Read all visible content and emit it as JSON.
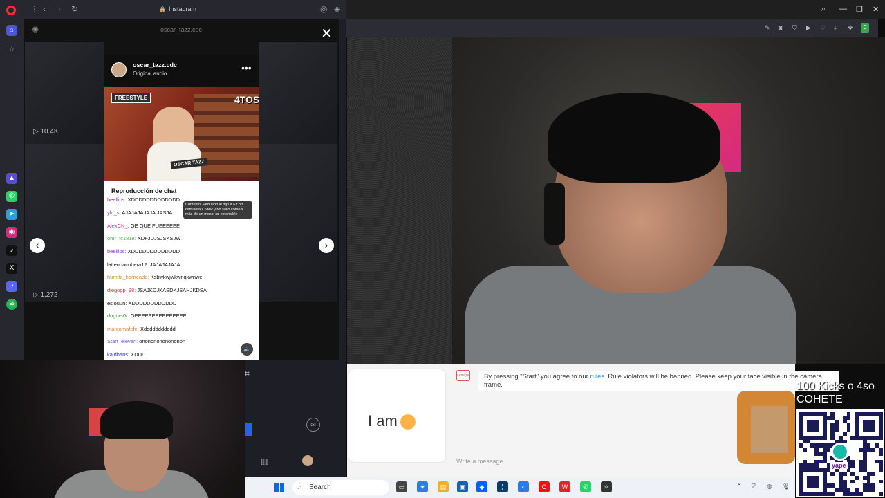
{
  "browser": {
    "tab_title": "Instagram",
    "ig_username_top": "oscar_tazz.cdc",
    "views_1": "10.4K",
    "views_2": "1,272"
  },
  "reel": {
    "username": "oscar_tazz.cdc",
    "audio": "Original audio",
    "video_badge_left": "FREESTYLE",
    "video_badge_right": "4TOS",
    "video_badge_name": "OSCAR TAZZ",
    "chat_title": "Reproducción de chat",
    "tooltip": "Contexto: Peduano le dijo a Ez no camiseta x SMP y no salio como x más de un mes x su extensible",
    "messages": [
      {
        "user": "beellips:",
        "text": "XDDDDDDDDDDDDD",
        "color": "#8a3bd6"
      },
      {
        "user": "ylu_s:",
        "text": "AJAJAJAJAJA JASJA",
        "color": "#8a3bd6"
      },
      {
        "user": "AlexCN_:",
        "text": "OE QUE FUEEEEEE",
        "color": "#d63b8f"
      },
      {
        "user": "omr_fc1818:",
        "text": "XDFJDJSJSKSJW",
        "color": "#4db54d"
      },
      {
        "user": "beellips:",
        "text": "XDDDDDDDDDDDDD",
        "color": "#8a3bd6"
      },
      {
        "user": "latiendacubera12:",
        "text": "JAJAJAJAJA",
        "color": "#111111"
      },
      {
        "user": "humita_horneada:",
        "text": "Ksbwkwjwkwnqkwnwe",
        "color": "#d68a3b"
      },
      {
        "user": "diegogp_98:",
        "text": "JSAJKDJKASDKJSAHJKDSA",
        "color": "#d63b3b"
      },
      {
        "user": "eslouun:",
        "text": "XDDDDDDDDDDDD",
        "color": "#111111"
      },
      {
        "user": "dogors0r:",
        "text": "OEEEEEEEEEEEEEEE",
        "color": "#3b9e3b"
      },
      {
        "user": "marcomafefe:",
        "text": "Xddddddddddd",
        "color": "#d6843b"
      },
      {
        "user": "Start_eleven:",
        "text": "onononononononon",
        "color": "#6a5bd6"
      },
      {
        "user": "kaidhans:",
        "text": "XDDD",
        "color": "#2b3bbf"
      }
    ]
  },
  "omegle": {
    "iam_text": "I am",
    "rules_prefix": "By pressing \"Start\" you agree to our ",
    "rules_link": "rules",
    "rules_suffix": ". Rule violators will be banned. Please keep your face visible in the camera frame.",
    "message_placeholder": "Write a message",
    "rules_icon_label": "Omegle"
  },
  "overlay": {
    "kicks_line1": "100 Kicks o 4so",
    "kicks_line2": "COHETE",
    "qr_brand": "yape"
  },
  "toolbar": {
    "counter_badge": "0"
  },
  "taskbar": {
    "search_label": "Search"
  }
}
